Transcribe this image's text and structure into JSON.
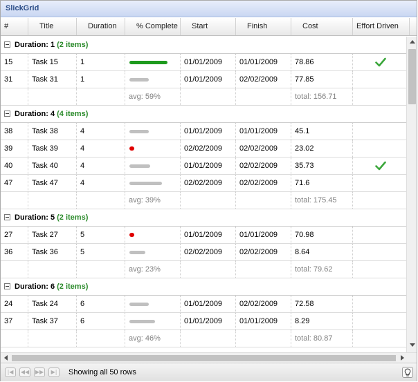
{
  "window": {
    "title": "SlickGrid"
  },
  "columns": [
    {
      "label": "#",
      "key": "id"
    },
    {
      "label": "Title",
      "key": "title"
    },
    {
      "label": "Duration",
      "key": "duration"
    },
    {
      "label": "% Complete",
      "key": "pct"
    },
    {
      "label": "Start",
      "key": "start"
    },
    {
      "label": "Finish",
      "key": "finish"
    },
    {
      "label": "Cost",
      "key": "cost"
    },
    {
      "label": "Effort Driven",
      "key": "effort"
    }
  ],
  "groups": [
    {
      "title": "Duration: 1",
      "count": "(2 items)",
      "rows": [
        {
          "id": "15",
          "title": "Task 15",
          "duration": "1",
          "pct": 1.0,
          "start": "01/01/2009",
          "finish": "01/01/2009",
          "cost": "78.86",
          "effort": true
        },
        {
          "id": "31",
          "title": "Task 31",
          "duration": "1",
          "pct": 0.5,
          "start": "01/01/2009",
          "finish": "02/02/2009",
          "cost": "77.85",
          "effort": false
        }
      ],
      "totals": {
        "pct": "avg: 59%",
        "cost": "total: 156.71"
      }
    },
    {
      "title": "Duration: 4",
      "count": "(4 items)",
      "rows": [
        {
          "id": "38",
          "title": "Task 38",
          "duration": "4",
          "pct": 0.5,
          "start": "01/01/2009",
          "finish": "01/01/2009",
          "cost": "45.1",
          "effort": false
        },
        {
          "id": "39",
          "title": "Task 39",
          "duration": "4",
          "pct": 0.05,
          "start": "02/02/2009",
          "finish": "02/02/2009",
          "cost": "23.02",
          "effort": false
        },
        {
          "id": "40",
          "title": "Task 40",
          "duration": "4",
          "pct": 0.55,
          "start": "01/01/2009",
          "finish": "02/02/2009",
          "cost": "35.73",
          "effort": true
        },
        {
          "id": "47",
          "title": "Task 47",
          "duration": "4",
          "pct": 0.85,
          "start": "02/02/2009",
          "finish": "02/02/2009",
          "cost": "71.6",
          "effort": false
        }
      ],
      "totals": {
        "pct": "avg: 39%",
        "cost": "total: 175.45"
      }
    },
    {
      "title": "Duration: 5",
      "count": "(2 items)",
      "rows": [
        {
          "id": "27",
          "title": "Task 27",
          "duration": "5",
          "pct": 0.08,
          "start": "01/01/2009",
          "finish": "01/01/2009",
          "cost": "70.98",
          "effort": false
        },
        {
          "id": "36",
          "title": "Task 36",
          "duration": "5",
          "pct": 0.42,
          "start": "02/02/2009",
          "finish": "02/02/2009",
          "cost": "8.64",
          "effort": false
        }
      ],
      "totals": {
        "pct": "avg: 23%",
        "cost": "total: 79.62"
      }
    },
    {
      "title": "Duration: 6",
      "count": "(2 items)",
      "rows": [
        {
          "id": "24",
          "title": "Task 24",
          "duration": "6",
          "pct": 0.5,
          "start": "01/01/2009",
          "finish": "02/02/2009",
          "cost": "72.58",
          "effort": false
        },
        {
          "id": "37",
          "title": "Task 37",
          "duration": "6",
          "pct": 0.68,
          "start": "01/01/2009",
          "finish": "01/01/2009",
          "cost": "8.29",
          "effort": false
        }
      ],
      "totals": {
        "pct": "avg: 46%",
        "cost": "total: 80.87"
      }
    }
  ],
  "pager": {
    "status": "Showing all 50 rows",
    "buttons": [
      "first-page",
      "previous-page",
      "next-page",
      "last-page"
    ]
  },
  "colors": {
    "complete": "#1d9a1d",
    "low": "#e00000",
    "partial": "#c0c0c0",
    "group_count": "#2a8a2a",
    "checkmark": "#3aa63a"
  }
}
